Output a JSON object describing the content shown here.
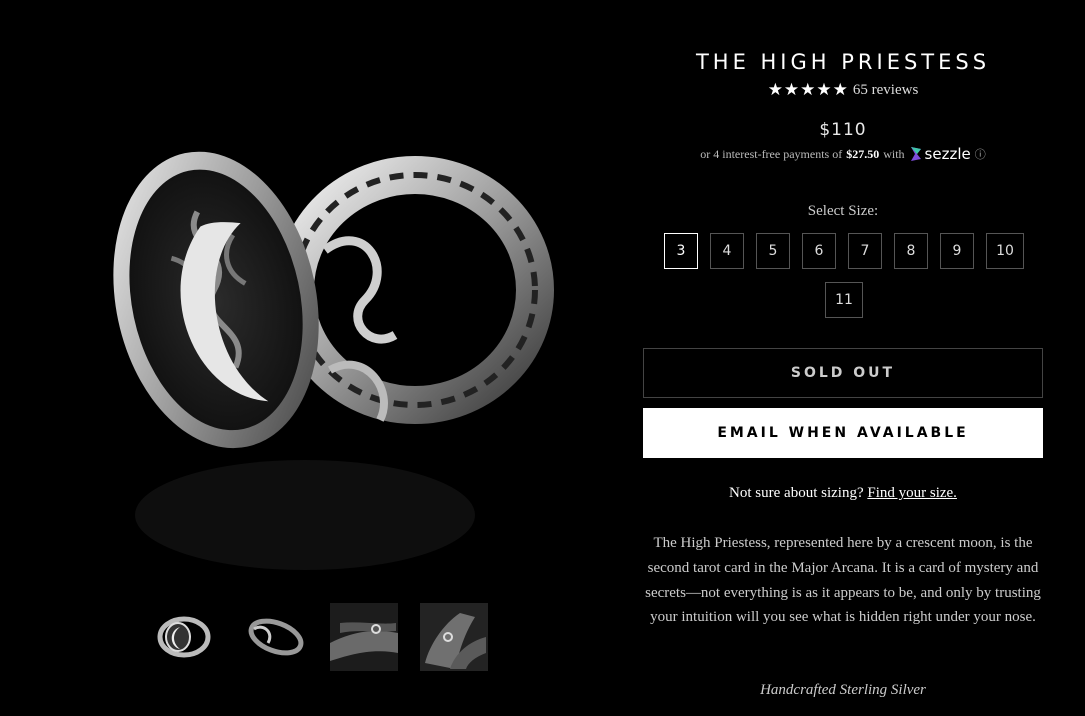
{
  "product": {
    "title": "THE HIGH PRIESTESS",
    "stars": "★★★★★",
    "rating_value": 5,
    "reviews": "65 reviews",
    "price": "$110",
    "installment_prefix": "or 4 interest-free payments of",
    "installment_amount": "$27.50",
    "installment_with": "with",
    "payment_brand": "sezzle",
    "info_icon": "ⓘ"
  },
  "sizes": {
    "label": "Select Size:",
    "options": [
      "3",
      "4",
      "5",
      "6",
      "7",
      "8",
      "9",
      "10",
      "11"
    ],
    "selected": "3"
  },
  "buttons": {
    "sold_out": "SOLD OUT",
    "email": "EMAIL WHEN AVAILABLE"
  },
  "sizing_help": {
    "text": "Not sure about sizing?",
    "link": "Find your size."
  },
  "description": "The High Priestess, represented here by a crescent moon, is the second tarot card in the Major Arcana. It is a card of mystery and secrets—not everything is as it appears to be, and only by trusting your intuition will you see what is hidden right under your nose.",
  "material": "Handcrafted Sterling Silver",
  "colors": {
    "background": "#000000",
    "accent": "#ffffff"
  }
}
